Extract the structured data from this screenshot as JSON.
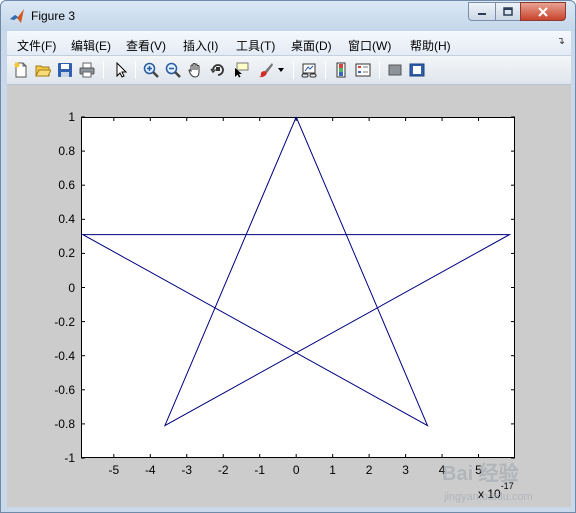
{
  "window": {
    "title": "Figure 3"
  },
  "menubar": {
    "items": [
      "文件(F)",
      "编辑(E)",
      "查看(V)",
      "插入(I)",
      "工具(T)",
      "桌面(D)",
      "窗口(W)",
      "帮助(H)"
    ],
    "overflow_icon": "chevron-double-down-icon"
  },
  "toolbar": {
    "buttons": [
      {
        "name": "new-figure-icon"
      },
      {
        "name": "open-file-icon"
      },
      {
        "name": "save-icon"
      },
      {
        "name": "print-icon"
      },
      {
        "name": "edit-plot-arrow-icon"
      },
      {
        "name": "zoom-in-icon"
      },
      {
        "name": "zoom-out-icon"
      },
      {
        "name": "pan-hand-icon"
      },
      {
        "name": "rotate-3d-icon"
      },
      {
        "name": "data-cursor-icon"
      },
      {
        "name": "brush-icon"
      },
      {
        "name": "brush-dropdown-icon"
      },
      {
        "name": "link-plot-icon"
      },
      {
        "name": "insert-colorbar-icon"
      },
      {
        "name": "insert-legend-icon"
      },
      {
        "name": "hide-plot-tools-icon"
      },
      {
        "name": "show-plot-tools-icon"
      }
    ]
  },
  "chart_data": {
    "type": "line",
    "title": "",
    "xlabel": "",
    "ylabel": "",
    "x_scale_factor": "x 10-17",
    "xlim": [
      -5.9,
      6.0
    ],
    "ylim": [
      -1,
      1
    ],
    "x_ticks": [
      -5,
      -4,
      -3,
      -2,
      -1,
      0,
      1,
      2,
      3,
      4,
      5
    ],
    "y_ticks": [
      1,
      0.8,
      0.6,
      0.4,
      0.2,
      0,
      -0.2,
      -0.4,
      -0.6,
      -0.8,
      -1
    ],
    "x_tick_labels": [
      "-5",
      "-4",
      "-3",
      "-2",
      "-1",
      "0",
      "1",
      "2",
      "3",
      "4",
      "5"
    ],
    "y_tick_labels": [
      "1",
      "0.8",
      "0.6",
      "0.4",
      "0.2",
      "0",
      "-0.2",
      "-0.4",
      "-0.6",
      "-0.8",
      "-1"
    ],
    "grid": false,
    "series": [
      {
        "color": "#000080",
        "x": [
          0.0,
          3.6,
          -5.85,
          5.85,
          -3.6,
          0.0
        ],
        "y": [
          1.0,
          -0.81,
          0.31,
          0.31,
          -0.81,
          1.0
        ]
      }
    ]
  },
  "watermark": {
    "text": "Bai 经验",
    "subtext": "jingyan.baidu.com"
  }
}
